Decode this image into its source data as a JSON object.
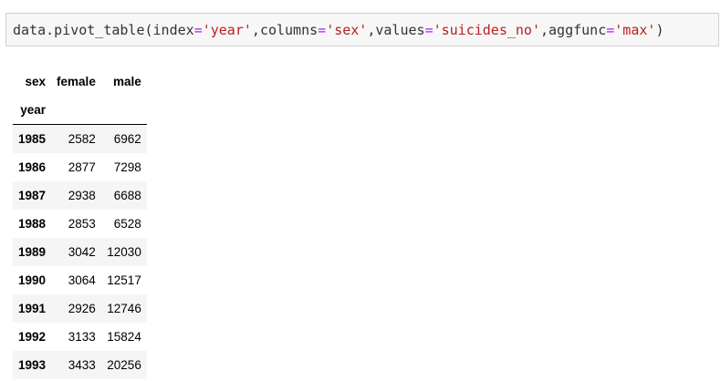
{
  "code_cell": {
    "tokens": [
      {
        "text": "data",
        "kind": "kw"
      },
      {
        "text": ".",
        "kind": "kw"
      },
      {
        "text": "pivot_table",
        "kind": "fn"
      },
      {
        "text": "(",
        "kind": "paren"
      },
      {
        "text": "index",
        "kind": "kw"
      },
      {
        "text": "=",
        "kind": "eq"
      },
      {
        "text": "'year'",
        "kind": "str"
      },
      {
        "text": ",",
        "kind": "kw"
      },
      {
        "text": "columns",
        "kind": "kw"
      },
      {
        "text": "=",
        "kind": "eq"
      },
      {
        "text": "'sex'",
        "kind": "str"
      },
      {
        "text": ",",
        "kind": "kw"
      },
      {
        "text": "values",
        "kind": "kw"
      },
      {
        "text": "=",
        "kind": "eq"
      },
      {
        "text": "'suicides_no'",
        "kind": "str"
      },
      {
        "text": ",",
        "kind": "kw"
      },
      {
        "text": "aggfunc",
        "kind": "kw"
      },
      {
        "text": "=",
        "kind": "eq"
      },
      {
        "text": "'max'",
        "kind": "str"
      },
      {
        "text": ")",
        "kind": "paren"
      }
    ]
  },
  "table": {
    "columns_name": "sex",
    "index_name": "year",
    "columns": [
      "female",
      "male"
    ],
    "rows": [
      {
        "year": "1985",
        "female": "2582",
        "male": "6962"
      },
      {
        "year": "1986",
        "female": "2877",
        "male": "7298"
      },
      {
        "year": "1987",
        "female": "2938",
        "male": "6688"
      },
      {
        "year": "1988",
        "female": "2853",
        "male": "6528"
      },
      {
        "year": "1989",
        "female": "3042",
        "male": "12030"
      },
      {
        "year": "1990",
        "female": "3064",
        "male": "12517"
      },
      {
        "year": "1991",
        "female": "2926",
        "male": "12746"
      },
      {
        "year": "1992",
        "female": "3133",
        "male": "15824"
      },
      {
        "year": "1993",
        "female": "3433",
        "male": "20256"
      }
    ]
  },
  "colors": {
    "string_literal": "#ba2121",
    "operator": "#aa22ff",
    "cell_background": "#f7f7f7",
    "stripe": "#f5f5f5"
  }
}
